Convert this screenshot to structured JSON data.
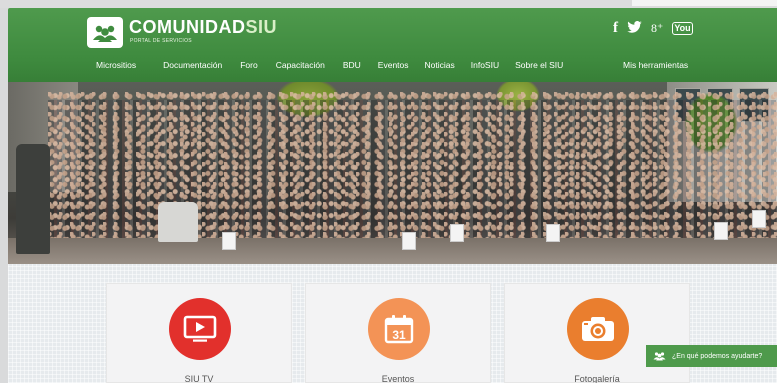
{
  "header": {
    "brand_main": "COMUNIDAD",
    "brand_accent": "SIU",
    "brand_subtitle": "PORTAL DE SERVICIOS",
    "logo_icon": "people-icon",
    "brand_color": "#3f8c3f",
    "social": [
      {
        "icon": "facebook-icon",
        "glyph": "f"
      },
      {
        "icon": "twitter-icon",
        "glyph": "🐦"
      },
      {
        "icon": "googleplus-icon",
        "glyph": "8⁺"
      },
      {
        "icon": "youtube-icon",
        "glyph": "You"
      }
    ],
    "nav": [
      "Micrositios",
      "Documentación",
      "Foro",
      "Capacitación",
      "BDU",
      "Eventos",
      "Noticias",
      "InfoSIU",
      "Sobre el SIU"
    ],
    "tools": "Mis herramientas"
  },
  "cards": [
    {
      "label": "SIU TV",
      "icon": "play-icon",
      "color": "#e2302c"
    },
    {
      "label": "Eventos",
      "icon": "calendar-icon",
      "color": "#f39356",
      "number": "31"
    },
    {
      "label": "Fotogalería",
      "icon": "camera-icon",
      "color": "#ea7e2e"
    }
  ],
  "chat": {
    "label": "¿En qué podemos ayudarte?",
    "icon": "people-icon",
    "color": "#4e9a4b"
  }
}
